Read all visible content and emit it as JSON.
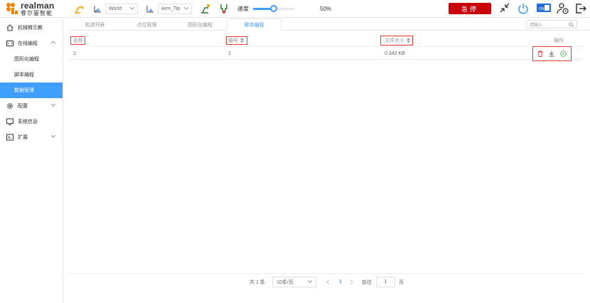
{
  "brand": {
    "name_en": "realman",
    "name_cn": "睿尔曼智能"
  },
  "toolbar": {
    "frame_select": "World",
    "tool_select": "Arm_Tip",
    "speed_label": "速度",
    "speed_value": "50%",
    "speed_fraction": 0.5,
    "estop_label": "急停"
  },
  "sidebar": {
    "items": [
      {
        "label": "机械臂示教"
      },
      {
        "label": "在线编程"
      },
      {
        "label": "图形化编程"
      },
      {
        "label": "脚本编程"
      },
      {
        "label": "数据管理"
      },
      {
        "label": "配置"
      },
      {
        "label": "系统信息"
      },
      {
        "label": "扩展"
      }
    ]
  },
  "tabs": [
    {
      "label": "轨迹列表"
    },
    {
      "label": "点位管理"
    },
    {
      "label": "图形化编程"
    },
    {
      "label": "脚本编程"
    }
  ],
  "search": {
    "placeholder": "请输入"
  },
  "table": {
    "columns": [
      "名称",
      "编号",
      "文件大小",
      "操作"
    ],
    "rows": [
      {
        "name": "1",
        "id": "1",
        "size": "0.342 KB"
      }
    ]
  },
  "pagination": {
    "total": "共 1 条",
    "page_size": "10条/页",
    "current": "1",
    "goto_label": "前往",
    "goto_value": "1",
    "page_unit": "页"
  },
  "colors": {
    "accent": "#409eff",
    "estop": "#c8000a",
    "highlight": "#e53935",
    "run": "#4caf50"
  }
}
